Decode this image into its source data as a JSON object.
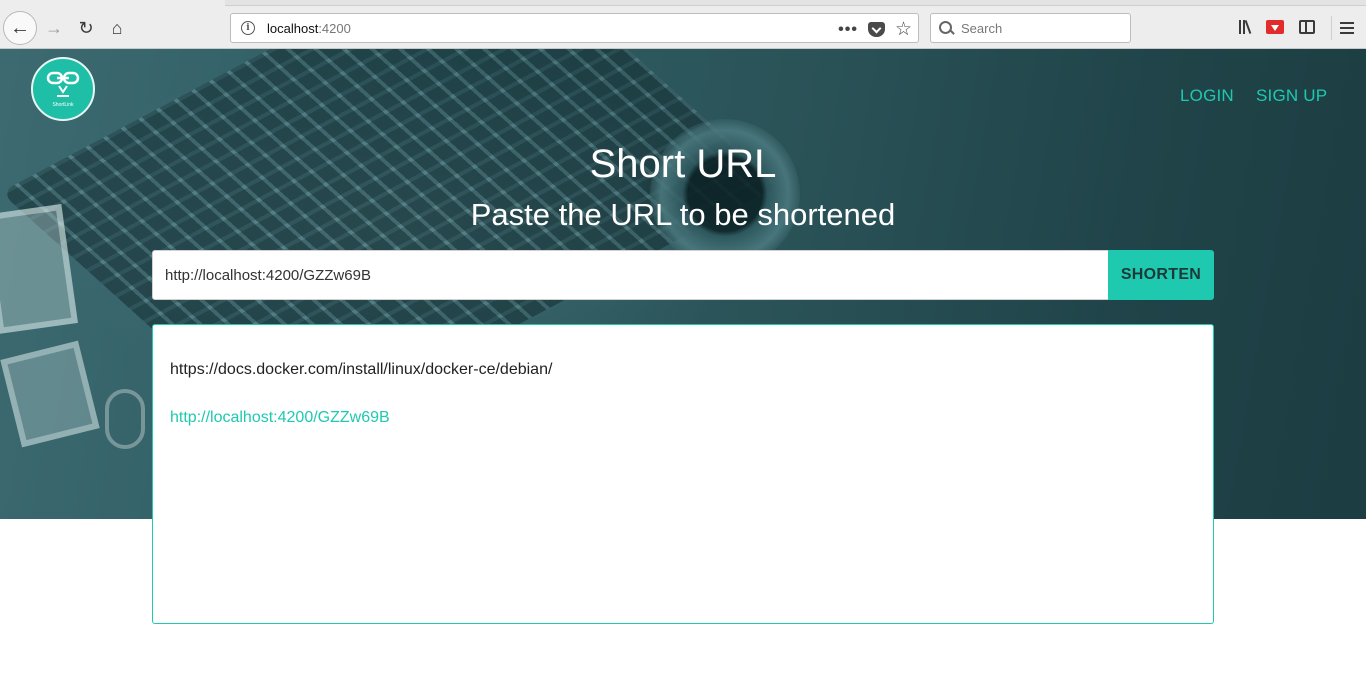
{
  "browser": {
    "url_host": "localhost",
    "url_port": ":4200",
    "search_placeholder": "Search",
    "icons": [
      "back-icon",
      "forward-icon",
      "reload-icon",
      "home-icon",
      "info-icon",
      "more-icon",
      "pocket-icon",
      "bookmark-star-icon",
      "search-icon",
      "library-icon",
      "save-icon",
      "sidebar-icon",
      "menu-icon"
    ]
  },
  "site": {
    "logo_text": "ShortLink",
    "nav": {
      "login": "LOGIN",
      "signup": "SIGN UP"
    },
    "colors": {
      "accent": "#1fc9b0"
    }
  },
  "hero": {
    "title": "Short URL",
    "subtitle": "Paste the URL to be shortened"
  },
  "form": {
    "input_value": "http://localhost:4200/GZZw69B",
    "button_label": "SHORTEN"
  },
  "result": {
    "original_url": "https://docs.docker.com/install/linux/docker-ce/debian/",
    "short_url": "http://localhost:4200/GZZw69B"
  }
}
